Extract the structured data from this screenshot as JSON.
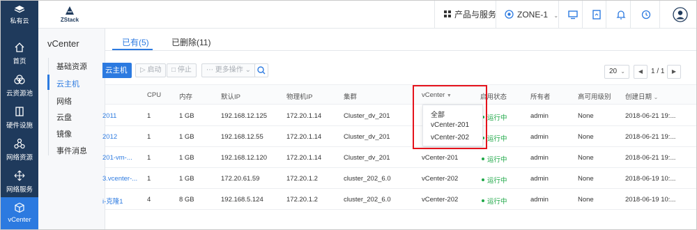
{
  "brand": {
    "name": "私有云"
  },
  "leftnav": [
    {
      "label": "首页",
      "icon": "home-icon"
    },
    {
      "label": "云资源池",
      "icon": "cloud-resource-icon"
    },
    {
      "label": "硬件设施",
      "icon": "hardware-icon"
    },
    {
      "label": "网络资源",
      "icon": "network-icon"
    },
    {
      "label": "网络服务",
      "icon": "network-service-icon"
    },
    {
      "label": "vCenter",
      "icon": "vcenter-cube-icon",
      "active": true
    }
  ],
  "topbar": {
    "logo_text": "ZStack",
    "products_label": "产品与服务",
    "zone_label": "ZONE-1"
  },
  "subnav": {
    "title": "vCenter",
    "items": [
      "基础资源",
      "云主机",
      "网络",
      "云盘",
      "镜像",
      "事件消息"
    ],
    "active_index": 1
  },
  "tabs": [
    "已有(5)",
    "已删除(11)"
  ],
  "toolbar": {
    "create_label": "云主机",
    "start_label": "启动",
    "stop_label": "停止",
    "more_label": "更多操作"
  },
  "pagination": {
    "page_size": "20",
    "page_text": "1 / 1"
  },
  "table": {
    "columns": [
      "CPU",
      "内存",
      "默认IP",
      "物理机IP",
      "集群",
      "vCenter",
      "启用状态",
      "所有者",
      "高可用级别",
      "创建日期"
    ],
    "rows": [
      {
        "name": "2011",
        "cpu": "1",
        "memory": "1 GB",
        "ip": "192.168.12.125",
        "host_ip": "172.20.1.14",
        "cluster": "Cluster_dv_201",
        "vcenter": "",
        "state": "运行中",
        "owner": "admin",
        "ha": "None",
        "created": "2018-06-21 19:..."
      },
      {
        "name": "2012",
        "cpu": "1",
        "memory": "1 GB",
        "ip": "192.168.12.55",
        "host_ip": "172.20.1.14",
        "cluster": "Cluster_dv_201",
        "vcenter": "",
        "state": "运行中",
        "owner": "admin",
        "ha": "None",
        "created": "2018-06-21 19:..."
      },
      {
        "name": "201-vm-...",
        "cpu": "1",
        "memory": "1 GB",
        "ip": "192.168.12.120",
        "host_ip": "172.20.1.14",
        "cluster": "Cluster_dv_201",
        "vcenter": "vCenter-201",
        "state": "运行中",
        "owner": "admin",
        "ha": "None",
        "created": "2018-06-21 19:..."
      },
      {
        "name": "3.vcenter-...",
        "cpu": "1",
        "memory": "1 GB",
        "ip": "172.20.61.59",
        "host_ip": "172.20.1.2",
        "cluster": "cluster_202_6.0",
        "vcenter": "vCenter-202",
        "state": "运行中",
        "owner": "admin",
        "ha": "None",
        "created": "2018-06-19 10:..."
      },
      {
        "name": "i-克隆1",
        "cpu": "4",
        "memory": "8 GB",
        "ip": "192.168.5.124",
        "host_ip": "172.20.1.2",
        "cluster": "cluster_202_6.0",
        "vcenter": "vCenter-202",
        "state": "运行中",
        "owner": "admin",
        "ha": "None",
        "created": "2018-06-19 10:..."
      }
    ]
  },
  "vcenter_filter": {
    "options": [
      "全部",
      "vCenter-201",
      "vCenter-202"
    ],
    "highlight_color": "#e5121b"
  },
  "colors": {
    "nav_bg": "#1f3a5c",
    "accent": "#2c7ae0",
    "running": "#1fa848"
  }
}
